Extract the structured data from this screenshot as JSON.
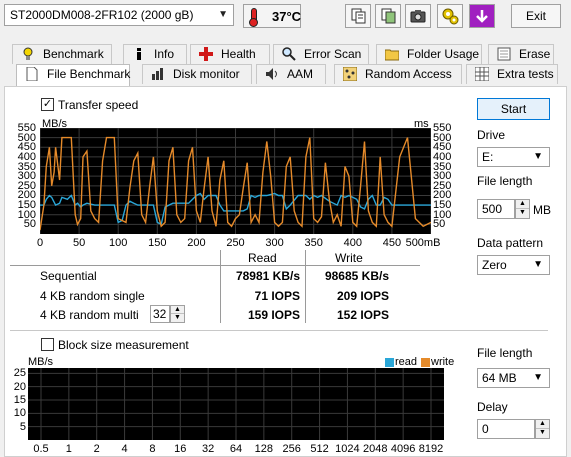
{
  "toolbar": {
    "drive": "ST2000DM008-2FR102 (2000 gB)",
    "temperature": "37°C",
    "exit_label": "Exit"
  },
  "tabs_row1": [
    "Benchmark",
    "Info",
    "Health",
    "Error Scan",
    "Folder Usage",
    "Erase"
  ],
  "tabs_row2": [
    "File Benchmark",
    "Disk monitor",
    "AAM",
    "Random Access",
    "Extra tests"
  ],
  "active_tab": "File Benchmark",
  "transfer": {
    "checkbox_label": "Transfer speed",
    "checked": true,
    "y_unit": "MB/s",
    "y_unit_right": "ms",
    "y_ticks": [
      "550",
      "500",
      "450",
      "400",
      "350",
      "300",
      "250",
      "200",
      "150",
      "100",
      "50"
    ],
    "x_ticks": [
      "0",
      "50",
      "100",
      "150",
      "200",
      "250",
      "300",
      "350",
      "400",
      "450",
      "500mB"
    ]
  },
  "results": {
    "col_read": "Read",
    "col_write": "Write",
    "rows": [
      {
        "label": "Sequential",
        "read": "78981 KB/s",
        "write": "98685 KB/s"
      },
      {
        "label": "4 KB random single",
        "read": "71 IOPS",
        "write": "209 IOPS"
      },
      {
        "label": "4 KB random multi",
        "read": "159 IOPS",
        "write": "152 IOPS"
      }
    ],
    "queue_depth": "32"
  },
  "block": {
    "checkbox_label": "Block size measurement",
    "checked": false,
    "y_unit": "MB/s",
    "legend_read": "read",
    "legend_write": "write",
    "y_ticks": [
      "25",
      "20",
      "15",
      "10",
      "5"
    ],
    "x_ticks": [
      "0.5",
      "1",
      "2",
      "4",
      "8",
      "16",
      "32",
      "64",
      "128",
      "256",
      "512",
      "1024",
      "2048",
      "4096",
      "8192"
    ]
  },
  "controls": {
    "start_label": "Start",
    "drive_label": "Drive",
    "drive_value": "E:",
    "file_length_label": "File length",
    "file_length_value": "500",
    "file_length_unit": "MB",
    "pattern_label": "Data pattern",
    "pattern_value": "Zero",
    "file_length2_label": "File length",
    "file_length2_value": "64 MB",
    "delay_label": "Delay",
    "delay_value": "0"
  },
  "colors": {
    "read_series": "#2aa7d8",
    "write_series": "#e58a2a",
    "graph_bg": "#000000",
    "grid": "#3a3a3a"
  },
  "chart_data": {
    "type": "line",
    "xlabel": "",
    "ylabel": "MB/s",
    "xlim": [
      0,
      500
    ],
    "ylim": [
      0,
      550
    ],
    "grid": true,
    "series": [
      {
        "name": "read",
        "x": [
          0,
          5,
          8,
          12,
          15,
          20,
          25,
          28,
          35,
          40,
          45,
          48,
          52,
          55,
          60,
          70,
          85,
          95,
          100,
          105,
          110,
          115,
          120,
          125,
          130,
          135,
          140,
          145,
          150,
          155,
          160,
          170,
          180,
          190,
          200,
          205,
          210,
          215,
          220,
          225,
          230,
          235,
          240,
          250,
          260,
          265,
          270,
          275,
          280,
          290,
          300,
          305,
          310,
          315,
          320,
          330,
          340,
          345,
          350,
          355,
          360,
          370,
          380,
          385,
          390,
          395,
          400,
          405,
          410,
          415,
          420,
          425,
          430,
          435,
          440,
          445,
          450,
          460,
          470,
          480,
          490,
          500
        ],
        "values": [
          150,
          150,
          180,
          200,
          190,
          150,
          160,
          190,
          180,
          200,
          150,
          160,
          140,
          150,
          160,
          150,
          150,
          150,
          60,
          70,
          150,
          170,
          160,
          150,
          150,
          150,
          150,
          150,
          60,
          50,
          140,
          160,
          160,
          160,
          200,
          210,
          180,
          200,
          200,
          200,
          150,
          120,
          120,
          120,
          120,
          130,
          200,
          190,
          200,
          200,
          210,
          200,
          200,
          130,
          150,
          200,
          200,
          180,
          200,
          190,
          200,
          170,
          150,
          200,
          190,
          200,
          190,
          180,
          140,
          130,
          180,
          200,
          150,
          150,
          190,
          180,
          150,
          150,
          150,
          150,
          150,
          150
        ]
      },
      {
        "name": "write",
        "x": [
          0,
          5,
          8,
          12,
          15,
          18,
          20,
          25,
          28,
          32,
          35,
          40,
          45,
          48,
          52,
          55,
          60,
          65,
          70,
          75,
          80,
          85,
          90,
          95,
          100,
          110,
          115,
          120,
          125,
          130,
          135,
          140,
          145,
          150,
          155,
          160,
          165,
          170,
          175,
          180,
          185,
          190,
          195,
          200,
          205,
          210,
          215,
          220,
          225,
          230,
          235,
          240,
          245,
          250,
          255,
          260,
          265,
          270,
          275,
          280,
          285,
          290,
          295,
          300,
          305,
          310,
          315,
          320,
          325,
          330,
          335,
          340,
          345,
          350,
          355,
          360,
          365,
          370,
          375,
          380,
          385,
          390,
          395,
          400,
          405,
          410,
          415,
          420,
          425,
          430,
          435,
          440,
          445,
          450,
          460,
          470,
          480,
          490,
          500
        ],
        "values": [
          20,
          150,
          350,
          450,
          250,
          320,
          450,
          280,
          500,
          500,
          500,
          500,
          100,
          50,
          80,
          400,
          430,
          120,
          80,
          60,
          380,
          500,
          500,
          500,
          80,
          60,
          240,
          380,
          420,
          100,
          60,
          240,
          400,
          120,
          40,
          60,
          380,
          450,
          100,
          60,
          80,
          380,
          450,
          120,
          60,
          240,
          400,
          120,
          40,
          280,
          380,
          60,
          40,
          80,
          100,
          240,
          370,
          60,
          100,
          60,
          320,
          480,
          300,
          60,
          40,
          60,
          350,
          400,
          120,
          60,
          40,
          400,
          500,
          80,
          60,
          90,
          370,
          180,
          60,
          100,
          40,
          350,
          300,
          60,
          40,
          250,
          480,
          120,
          60,
          40,
          400,
          100,
          60,
          40,
          400,
          500,
          80,
          40,
          60
        ]
      }
    ]
  }
}
